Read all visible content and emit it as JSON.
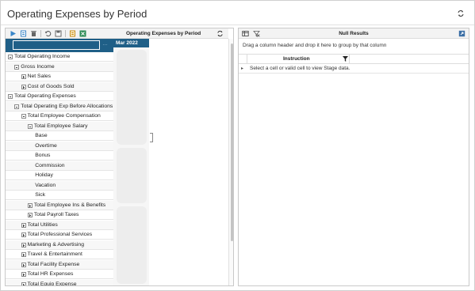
{
  "page": {
    "title": "Operating Expenses by Period"
  },
  "left_panel": {
    "column_header": "Operating Expenses by Period",
    "period_header": "Mar 2022",
    "rows": [
      {
        "label": "Total Operating Income",
        "expander": "minus",
        "indent": 0
      },
      {
        "label": "Gross Income",
        "expander": "minus",
        "indent": 1
      },
      {
        "label": "Net Sales",
        "expander": "plus",
        "indent": 2
      },
      {
        "label": "Cost of Goods Sold",
        "expander": "plus",
        "indent": 2
      },
      {
        "label": "Total Operating Expenses",
        "expander": "minus",
        "indent": 0
      },
      {
        "label": "Total Operating Exp Before Allocations",
        "expander": "minus",
        "indent": 1
      },
      {
        "label": "Total Employee Compensation",
        "expander": "minus",
        "indent": 2
      },
      {
        "label": "Total Employee Salary",
        "expander": "minus",
        "indent": 3
      },
      {
        "label": "Base",
        "expander": "none",
        "indent": 4
      },
      {
        "label": "Overtime",
        "expander": "none",
        "indent": 4
      },
      {
        "label": "Bonus",
        "expander": "none",
        "indent": 4
      },
      {
        "label": "Commission",
        "expander": "none",
        "indent": 4
      },
      {
        "label": "Holiday",
        "expander": "none",
        "indent": 4
      },
      {
        "label": "Vacation",
        "expander": "none",
        "indent": 4
      },
      {
        "label": "Sick",
        "expander": "none",
        "indent": 4
      },
      {
        "label": "Total Employee Ins & Benefits",
        "expander": "plus",
        "indent": 3
      },
      {
        "label": "Total Payroll Taxes",
        "expander": "plus",
        "indent": 3
      },
      {
        "label": "Total Utilities",
        "expander": "plus",
        "indent": 2
      },
      {
        "label": "Total Professional Services",
        "expander": "plus",
        "indent": 2
      },
      {
        "label": "Marketing & Advertising",
        "expander": "plus",
        "indent": 2
      },
      {
        "label": "Travel & Entertainment",
        "expander": "plus",
        "indent": 2
      },
      {
        "label": "Total Facility Expense",
        "expander": "plus",
        "indent": 2
      },
      {
        "label": "Total HR Expenses",
        "expander": "plus",
        "indent": 2
      },
      {
        "label": "Total Equip Expense",
        "expander": "plus",
        "indent": 2
      }
    ]
  },
  "right_panel": {
    "title": "Null Results",
    "group_hint": "Drag a column header and drop it here to group by that column",
    "column_header": "Instruction",
    "row_text": "Select a cell or valid cell to view Stage data."
  },
  "colors": {
    "accent": "#1f5f87",
    "toolbar_green": "#2e8b57",
    "toolbar_blue": "#2a7ab8"
  },
  "icons": {
    "toolbar_left": [
      "play-icon",
      "new-document-icon",
      "delete-icon",
      "undo-icon",
      "save-icon",
      "report-icon",
      "excel-icon"
    ],
    "header_right": "sync-icon",
    "right_toolbar": [
      "table-icon",
      "clear-filter-icon"
    ],
    "right_corner": "expand-icon"
  }
}
